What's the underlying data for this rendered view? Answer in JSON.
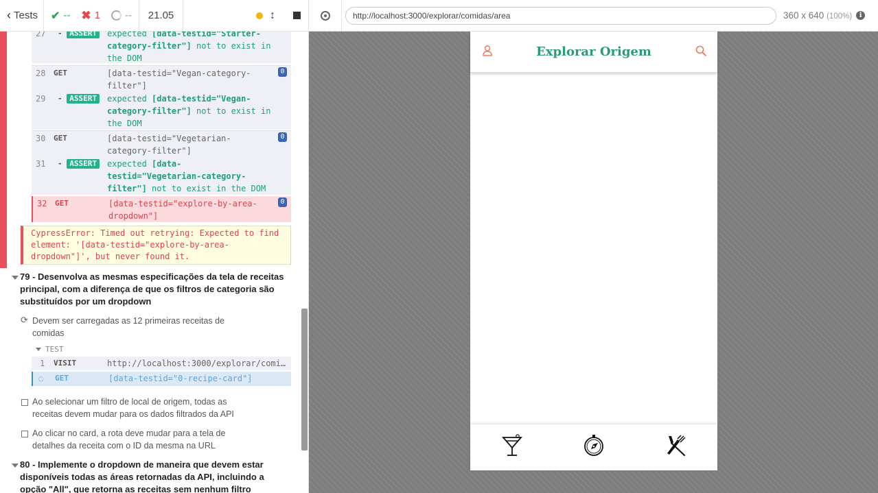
{
  "reporter": {
    "header": {
      "tests_label": "Tests",
      "passed": "--",
      "failed": "1",
      "pending": "--",
      "duration": "21.05"
    },
    "commands": [
      {
        "num": "27",
        "name": "ASSERT",
        "msg_a": "expected ",
        "msg_b": "[data-testid=\"Starter-category-filter\"]",
        "msg_c": " not to exist in the DOM"
      },
      {
        "num": "28",
        "name": "GET",
        "msg": "[data-testid=\"Vegan-category-filter\"]",
        "badge": "0"
      },
      {
        "num": "29",
        "name": "ASSERT",
        "msg_a": "expected ",
        "msg_b": "[data-testid=\"Vegan-category-filter\"]",
        "msg_c": " not to exist in the DOM"
      },
      {
        "num": "30",
        "name": "GET",
        "msg": "[data-testid=\"Vegetarian-category-filter\"]",
        "badge": "0"
      },
      {
        "num": "31",
        "name": "ASSERT",
        "msg_a": "expected ",
        "msg_b": "[data-testid=\"Vegetarian-category-filter\"]",
        "msg_c": " not to exist in the DOM"
      },
      {
        "num": "32",
        "name": "GET",
        "msg": "[data-testid=\"explore-by-area-dropdown\"]",
        "badge": "0"
      }
    ],
    "error": "CypressError: Timed out retrying: Expected to find element: '[data-testid=\"explore-by-area-dropdown\"]', but never found it.",
    "suite79": {
      "title": "79 - Desenvolva as mesmas especificações da tela de receitas principal, com a diferença de que os filtros de categoria são substituídos por um dropdown",
      "tests": [
        "Devem ser carregadas as 12 primeiras receitas de comidas",
        "Ao selecionar um filtro de local de origem, todas as receitas devem mudar para os dados filtrados da API",
        "Ao clicar no card, a rota deve mudar para a tela de detalhes da receita com o ID da mesma na URL"
      ],
      "test_header": "TEST",
      "commands": [
        {
          "num": "1",
          "name": "VISIT",
          "msg": "http://localhost:3000/explorar/comi…"
        },
        {
          "name": "GET",
          "msg": "[data-testid=\"0-recipe-card\"]"
        }
      ]
    },
    "suite80": {
      "title": "80 - Implemente o dropdown de maneira que devem estar disponíveis todas as áreas retornadas da API, incluindo a opção \"All\", que retorna as receitas sem nenhum filtro"
    }
  },
  "aut": {
    "url": "http://localhost:3000/explorar/comidas/area",
    "viewport": "360 x 640",
    "zoom": "(100%)",
    "info": "i"
  },
  "app": {
    "title": "Explorar Origem",
    "colors": {
      "accent": "#2d9a76",
      "icon": "#f2785c"
    }
  }
}
